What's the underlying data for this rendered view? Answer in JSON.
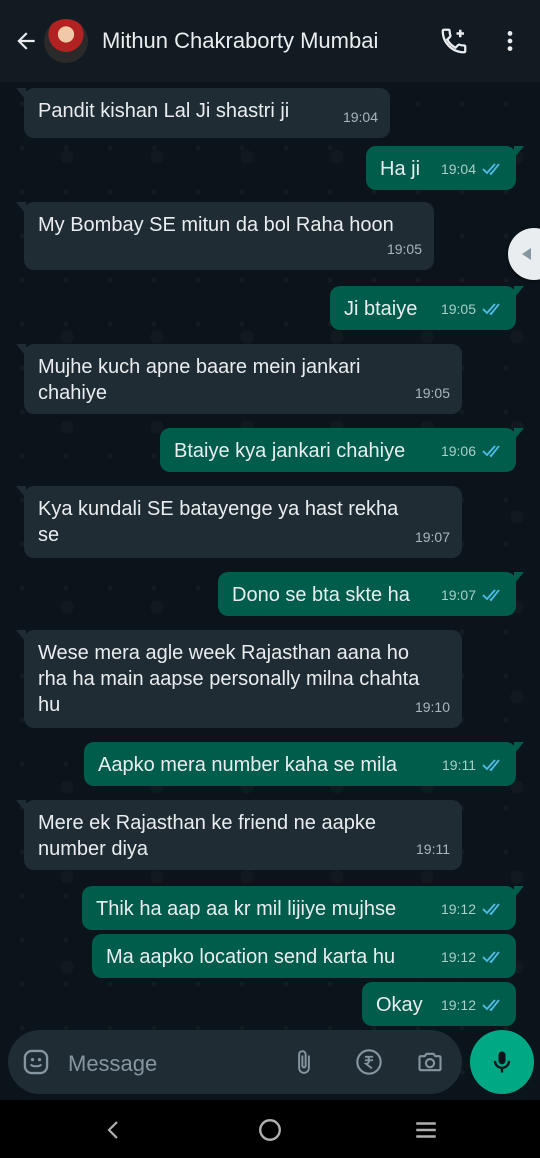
{
  "header": {
    "contact_name": "Mithun Chakraborty Mumbai",
    "icons": {
      "back": "back-arrow-icon",
      "call": "add-call-icon",
      "menu": "more-vertical-icon"
    }
  },
  "messages": [
    {
      "direction": "in",
      "text": "Pandit kishan Lal Ji shastri ji",
      "time": "19:04"
    },
    {
      "direction": "out",
      "text": "Ha ji",
      "time": "19:04",
      "status": "read"
    },
    {
      "direction": "in",
      "text": "My Bombay SE mitun da bol Raha hoon",
      "time": "19:05"
    },
    {
      "direction": "out",
      "text": "Ji btaiye",
      "time": "19:05",
      "status": "read"
    },
    {
      "direction": "in",
      "text": "Mujhe kuch apne baare mein jankari chahiye",
      "time": "19:05"
    },
    {
      "direction": "out",
      "text": "Btaiye kya jankari chahiye",
      "time": "19:06",
      "status": "read"
    },
    {
      "direction": "in",
      "text": "Kya kundali SE batayenge ya hast rekha se",
      "time": "19:07"
    },
    {
      "direction": "out",
      "text": "Dono se bta skte ha",
      "time": "19:07",
      "status": "read"
    },
    {
      "direction": "in",
      "text": "Wese mera agle week Rajasthan aana ho rha ha main aapse personally milna chahta hu",
      "time": "19:10"
    },
    {
      "direction": "out",
      "text": "Aapko mera number kaha se mila",
      "time": "19:11",
      "status": "read"
    },
    {
      "direction": "in",
      "text": "Mere ek Rajasthan ke friend ne aapke number diya",
      "time": "19:11"
    },
    {
      "direction": "out",
      "text": "Thik ha aap aa kr mil lijiye mujhse",
      "time": "19:12",
      "status": "read"
    },
    {
      "direction": "out",
      "text": "Ma aapko location send karta hu",
      "time": "19:12",
      "status": "read"
    },
    {
      "direction": "out",
      "text": "Okay",
      "time": "19:12",
      "status": "read"
    }
  ],
  "input": {
    "placeholder": "Message",
    "icons": {
      "emoji": "emoji-icon",
      "attach": "paperclip-icon",
      "payment": "rupee-icon",
      "camera": "camera-icon",
      "mic": "microphone-icon"
    }
  },
  "colors": {
    "background": "#0b141a",
    "header": "#111b21",
    "incoming_bubble": "#202c33",
    "outgoing_bubble": "#005c4b",
    "accent": "#00a884",
    "read_ticks": "#53bdeb"
  }
}
